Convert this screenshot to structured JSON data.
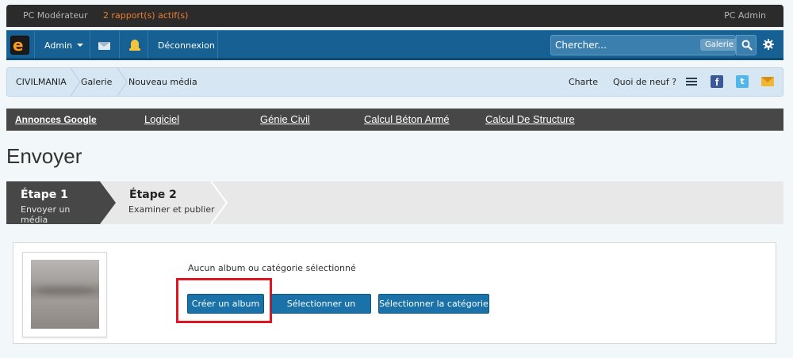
{
  "modbar": {
    "left_label": "PC Modérateur",
    "reports_label": "2 rapport(s) actif(s)",
    "right_label": "PC Admin"
  },
  "navbar": {
    "logo_letter": "e",
    "user_label": "Admin",
    "logout_label": "Déconnexion",
    "search_placeholder": "Chercher...",
    "search_scope": "Galerie"
  },
  "breadcrumb": {
    "items": [
      "CIVILMANIA",
      "Galerie",
      "Nouveau média"
    ],
    "right_links": [
      "Charte",
      "Quoi de neuf ?"
    ]
  },
  "ads": {
    "items": [
      "Annonces Google",
      "Logiciel",
      "Génie Civil",
      "Calcul Béton Armé",
      "Calcul De Structure"
    ]
  },
  "page": {
    "title": "Envoyer"
  },
  "steps": [
    {
      "title": "Étape 1",
      "subtitle": "Envoyer un média",
      "active": true
    },
    {
      "title": "Étape 2",
      "subtitle": "Examiner et publier",
      "active": false
    }
  ],
  "upload": {
    "status_text": "Aucun album ou catégorie sélectionné",
    "buttons": [
      "Créer un album",
      "Sélectionner un album",
      "Sélectionner la catégorie"
    ]
  },
  "colors": {
    "navbar": "#176093",
    "reports": "#f07d2a",
    "button": "#1a72a8",
    "highlight": "#e0151f"
  }
}
